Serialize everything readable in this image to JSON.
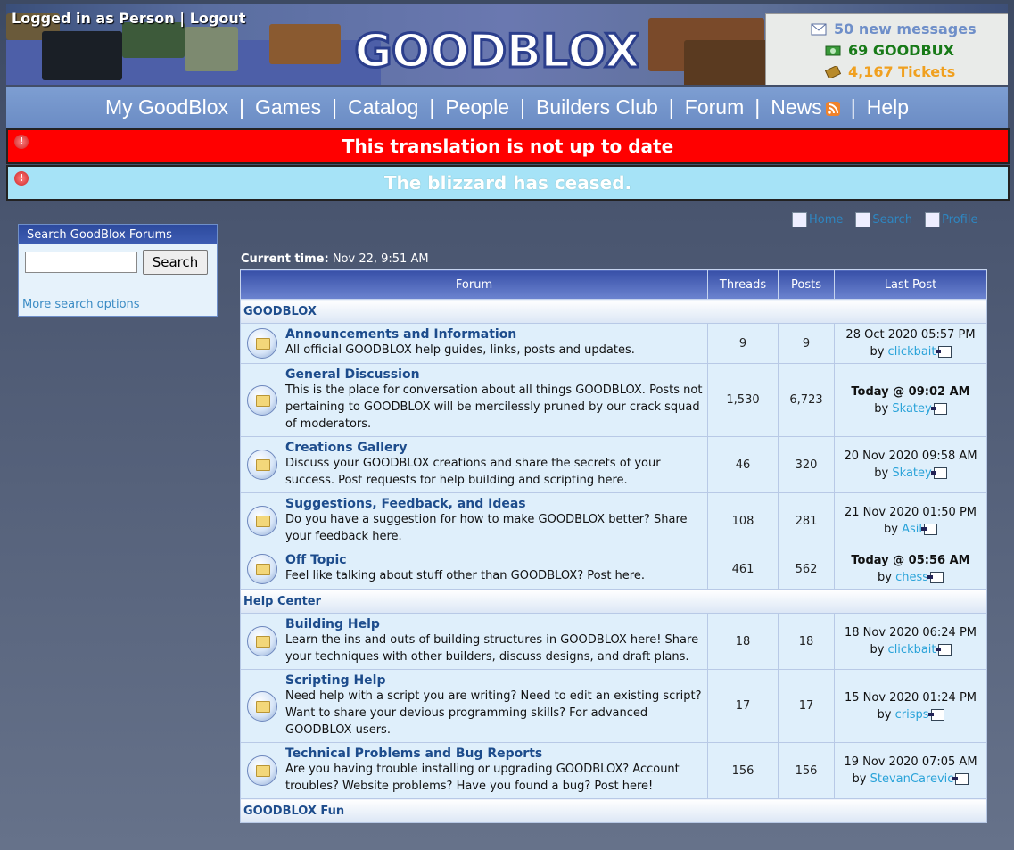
{
  "header": {
    "logged_in": "Logged in as Person",
    "separator": "|",
    "logout": "Logout",
    "logo_text": "GOODBLOX",
    "messages": "50 new messages",
    "goodbux": "69 GOODBUX",
    "tickets": "4,167 Tickets"
  },
  "nav": {
    "items": [
      "My GoodBlox",
      "Games",
      "Catalog",
      "People",
      "Builders Club",
      "Forum",
      "News",
      "Help"
    ],
    "sep": "|"
  },
  "banners": {
    "translation": "This translation is not up to date",
    "blizzard": "The blizzard has ceased."
  },
  "search": {
    "title": "Search GoodBlox Forums",
    "button": "Search",
    "more": "More search options",
    "value": ""
  },
  "toplinks": [
    "Home",
    "Search",
    "Profile"
  ],
  "current_time": {
    "label": "Current time:",
    "value": "Nov 22, 9:51 AM"
  },
  "table": {
    "headers": [
      "Forum",
      "Threads",
      "Posts",
      "Last Post"
    ],
    "categories": [
      {
        "name": "GOODBLOX",
        "forums": [
          {
            "name": "Announcements and Information",
            "desc": "All official GOODBLOX help guides, links, posts and updates.",
            "threads": "9",
            "posts": "9",
            "date": "28 Oct 2020 05:57 PM",
            "by": "by",
            "user": "clickbait"
          },
          {
            "name": "General Discussion",
            "desc": "This is the place for conversation about all things GOODBLOX. Posts not pertaining to GOODBLOX will be mercilessly pruned by our crack squad of moderators.",
            "threads": "1,530",
            "posts": "6,723",
            "date": "Today @ 09:02 AM",
            "by": "by",
            "user": "Skatey"
          },
          {
            "name": "Creations Gallery",
            "desc": "Discuss your GOODBLOX creations and share the secrets of your success. Post requests for help building and scripting here.",
            "threads": "46",
            "posts": "320",
            "date": "20 Nov 2020 09:58 AM",
            "by": "by",
            "user": "Skatey"
          },
          {
            "name": "Suggestions, Feedback, and Ideas",
            "desc": "Do you have a suggestion for how to make GOODBLOX better? Share your feedback here.",
            "threads": "108",
            "posts": "281",
            "date": "21 Nov 2020 01:50 PM",
            "by": "by",
            "user": "Asil"
          },
          {
            "name": "Off Topic",
            "desc": "Feel like talking about stuff other than GOODBLOX? Post here.",
            "threads": "461",
            "posts": "562",
            "date": "Today @ 05:56 AM",
            "by": "by",
            "user": "chess"
          }
        ]
      },
      {
        "name": "Help Center",
        "forums": [
          {
            "name": "Building Help",
            "desc": "Learn the ins and outs of building structures in GOODBLOX here! Share your techniques with other builders, discuss designs, and draft plans.",
            "threads": "18",
            "posts": "18",
            "date": "18 Nov 2020 06:24 PM",
            "by": "by",
            "user": "clickbait"
          },
          {
            "name": "Scripting Help",
            "desc": "Need help with a script you are writing? Need to edit an existing script? Want to share your devious programming skills? For advanced GOODBLOX users.",
            "threads": "17",
            "posts": "17",
            "date": "15 Nov 2020 01:24 PM",
            "by": "by",
            "user": "crisps"
          },
          {
            "name": "Technical Problems and Bug Reports",
            "desc": "Are you having trouble installing or upgrading GOODBLOX? Account troubles? Website problems? Have you found a bug? Post here!",
            "threads": "156",
            "posts": "156",
            "date": "19 Nov 2020 07:05 AM",
            "by": "by",
            "user": "StevanCarevic"
          }
        ]
      },
      {
        "name": "GOODBLOX Fun",
        "forums": []
      }
    ]
  }
}
